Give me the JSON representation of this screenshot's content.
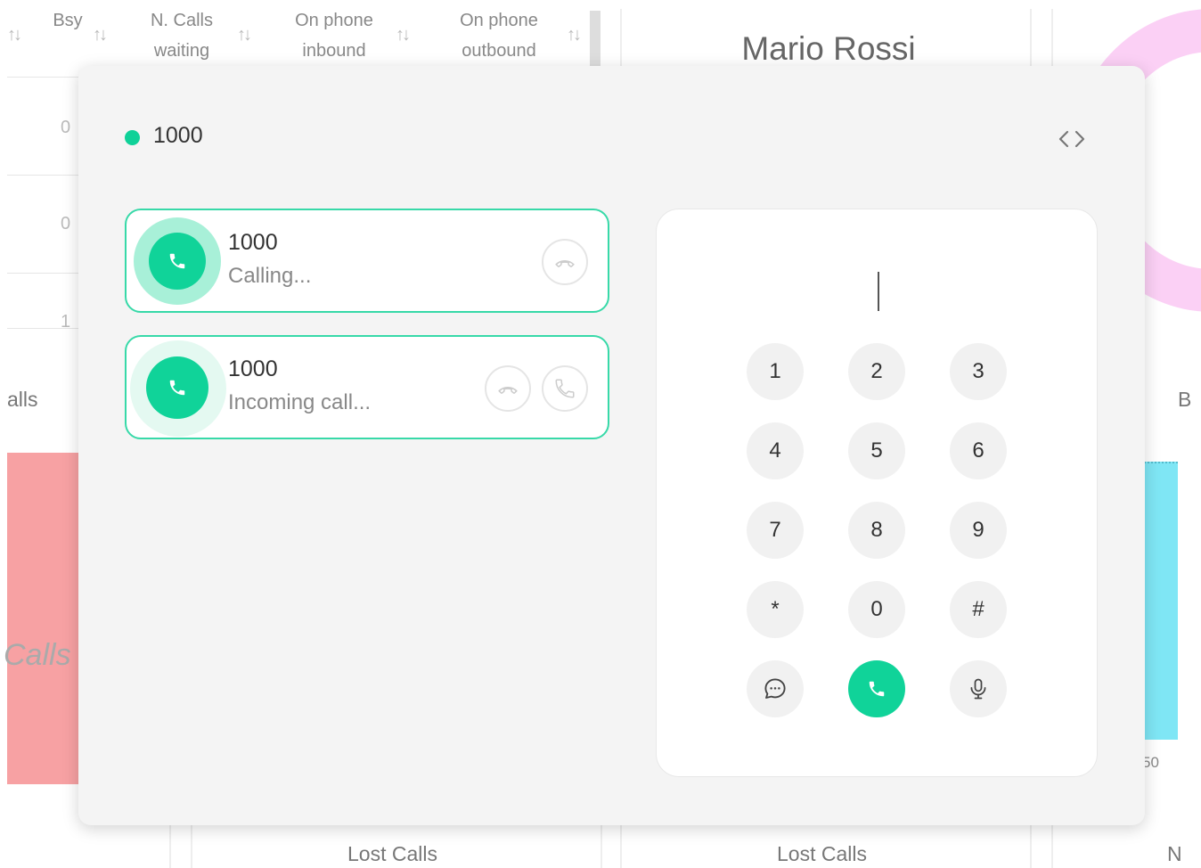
{
  "table": {
    "headers": [
      {
        "line1": "Bsy",
        "line2": ""
      },
      {
        "line1": "N. Calls",
        "line2": "waiting"
      },
      {
        "line1": "On phone",
        "line2": "inbound"
      },
      {
        "line1": "On phone",
        "line2": "outbound"
      }
    ],
    "rows": [
      "0",
      "0",
      "1"
    ],
    "sort_glyph": "↑↓"
  },
  "agent_card": {
    "name": "Mario Rossi"
  },
  "widgets": {
    "lost_left": "Lost Calls",
    "lost_right": "Lost Calls",
    "partial_calls": "alls",
    "partial_calls_italic": "Calls",
    "partial_b": "B",
    "partial_n": "N",
    "axis_tick": "50"
  },
  "colors": {
    "accent": "#10d399",
    "red_bar": "#f7a1a3",
    "cyan_bar": "#7fe6f5",
    "pink_ring": "#fbd0f5"
  },
  "softphone": {
    "extension": "1000",
    "status_color": "#10d399",
    "calls": [
      {
        "name": "1000",
        "status": "Calling..."
      },
      {
        "name": "1000",
        "status": "Incoming call..."
      }
    ],
    "dialer": {
      "value": "",
      "keys": [
        "1",
        "2",
        "3",
        "4",
        "5",
        "6",
        "7",
        "8",
        "9",
        "*",
        "0",
        "#"
      ]
    }
  }
}
